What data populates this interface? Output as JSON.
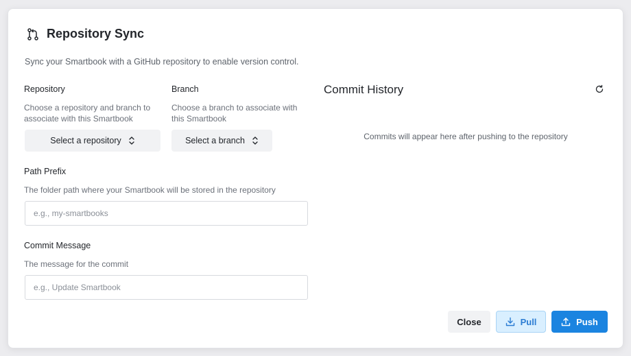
{
  "dialog": {
    "title": "Repository Sync",
    "title_icon": "git-pull-request-icon",
    "description": "Sync your Smartbook with a GitHub repository to enable version control."
  },
  "repository": {
    "label": "Repository",
    "help": "Choose a repository and branch to associate with this Smartbook",
    "select_label": "Select a repository",
    "select_icon": "chevron-up-down-icon"
  },
  "branch": {
    "label": "Branch",
    "help": "Choose a branch to associate with this Smartbook",
    "select_label": "Select a branch",
    "select_icon": "chevron-up-down-icon"
  },
  "path_prefix": {
    "label": "Path Prefix",
    "help": "The folder path where your Smartbook will be stored in the repository",
    "value": "",
    "placeholder": "e.g., my-smartbooks"
  },
  "commit_message": {
    "label": "Commit Message",
    "help": "The message for the commit",
    "value": "",
    "placeholder": "e.g., Update Smartbook"
  },
  "commit_history": {
    "title": "Commit History",
    "refresh_icon": "refresh-icon",
    "empty_text": "Commits will appear here after pushing to the repository"
  },
  "actions": {
    "close_label": "Close",
    "pull_label": "Pull",
    "pull_icon": "download-icon",
    "push_label": "Push",
    "push_icon": "upload-icon"
  },
  "colors": {
    "primary": "#1b84e0",
    "pull_bg": "#d9efff",
    "pull_text": "#2b7cd3"
  }
}
